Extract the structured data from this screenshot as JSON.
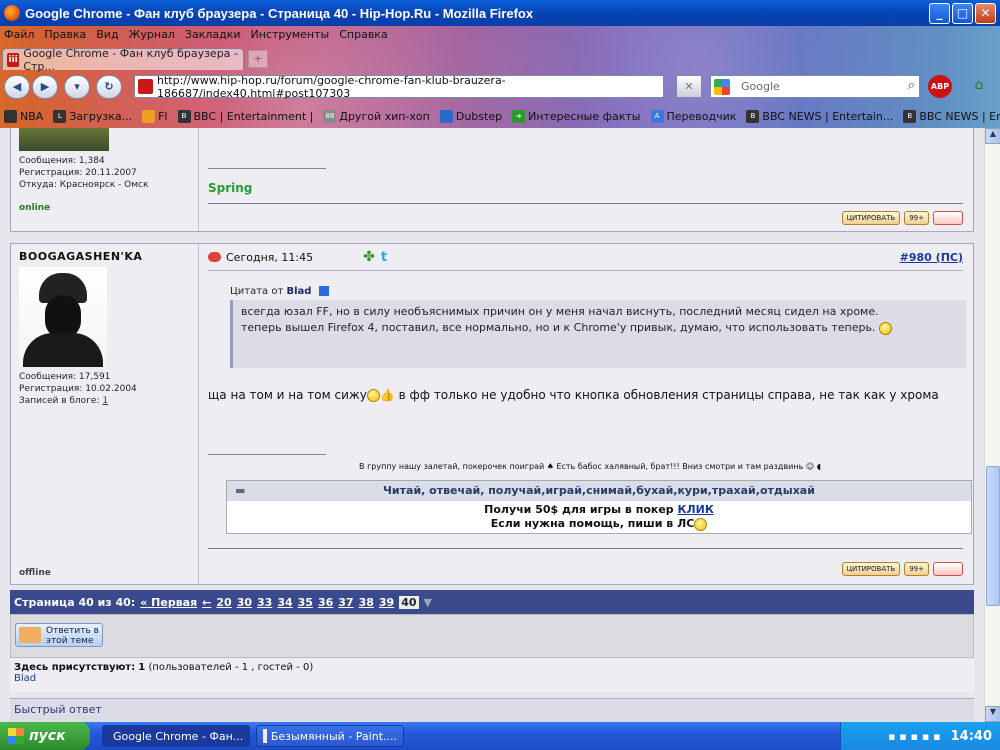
{
  "window": {
    "title": "Google Chrome - Фан клуб браузера - Страница 40 - Hip-Hop.Ru - Mozilla Firefox"
  },
  "menu": [
    "Файл",
    "Правка",
    "Вид",
    "Журнал",
    "Закладки",
    "Инструменты",
    "Справка"
  ],
  "tab": {
    "label": "Google Chrome - Фан клуб браузера - Стр..."
  },
  "nav": {
    "url": "http://www.hip-hop.ru/forum/google-chrome-fan-klub-brauzera-186687/index40.html#post107303",
    "search_placeholder": "Google"
  },
  "bookmarks": [
    "NBA",
    "Загрузка...",
    "Fl",
    "BBC | Entertainment |",
    "Другой хип-хоп",
    "Dubstep",
    "Интересные факты",
    "Переводчик",
    "BBC NEWS | Entertain...",
    "BBC NEWS | Entertain..."
  ],
  "post1": {
    "msgs": "Сообщения: 1,384",
    "reg": "Регистрация: 20.11.2007",
    "from": "Откуда: Красноярск - Омск",
    "status": "online",
    "signature": "Spring"
  },
  "post2": {
    "username": "BOOGAGASHEN'KA",
    "msgs": "Сообщения: 17,591",
    "reg": "Регистрация: 10.02.2004",
    "blog_label": "Записей в блоге:",
    "blog_count": "1",
    "status": "offline",
    "time": "Сегодня, 11:45",
    "post_no": "#980",
    "ps": "ПС",
    "quote_from": "Цитата от",
    "quote_author": "Blad",
    "quote_text1": "всегда юзал FF, но в силу необъяснимых причин он у меня начал виснуть, последний месяц сидел на хроме.",
    "quote_text2": "теперь вышел Firefox 4, поставил, все нормально, но и к Chrome'у привык, думаю, что использовать теперь.",
    "body1": "ща на том и на том сижу",
    "body2": " в фф только не удобно что кнопка обновления страницы справа, не так как у хрома",
    "sig_line": "В группу нашу залетай, покерочек поиграй ♠ Есть бабос халявный, брат!!! Вниз смотри и там раздвинь",
    "ad_head": "Читай, отвечай, получай,играй,снимай,бухай,кури,трахай,отдыхай",
    "ad_line1": "Получи 50$ для игры в покер",
    "ad_link": "КЛИК",
    "ad_line2": "Если нужна помощь, пиши в ЛС"
  },
  "actions": {
    "quote": "ЦИТИРОВАТЬ",
    "multi": "99+"
  },
  "pager": {
    "label": "Страница 40 из 40:",
    "first": "« Первая",
    "prev": "←",
    "pages": [
      "20",
      "30",
      "33",
      "34",
      "35",
      "36",
      "37",
      "38",
      "39"
    ],
    "current": "40"
  },
  "reply": {
    "label": "Ответить в этой теме"
  },
  "presence": {
    "label": "Здесь присутствуют:",
    "count": "1",
    "detail": "(пользователей - 1 , гостей - 0)",
    "user": "Blad"
  },
  "quickreply": {
    "label": "Быстрый ответ"
  },
  "taskbar": {
    "start": "пуск",
    "task1": "Google Chrome - Фан...",
    "task2": "Безымянный - Paint....",
    "clock": "14:40"
  }
}
